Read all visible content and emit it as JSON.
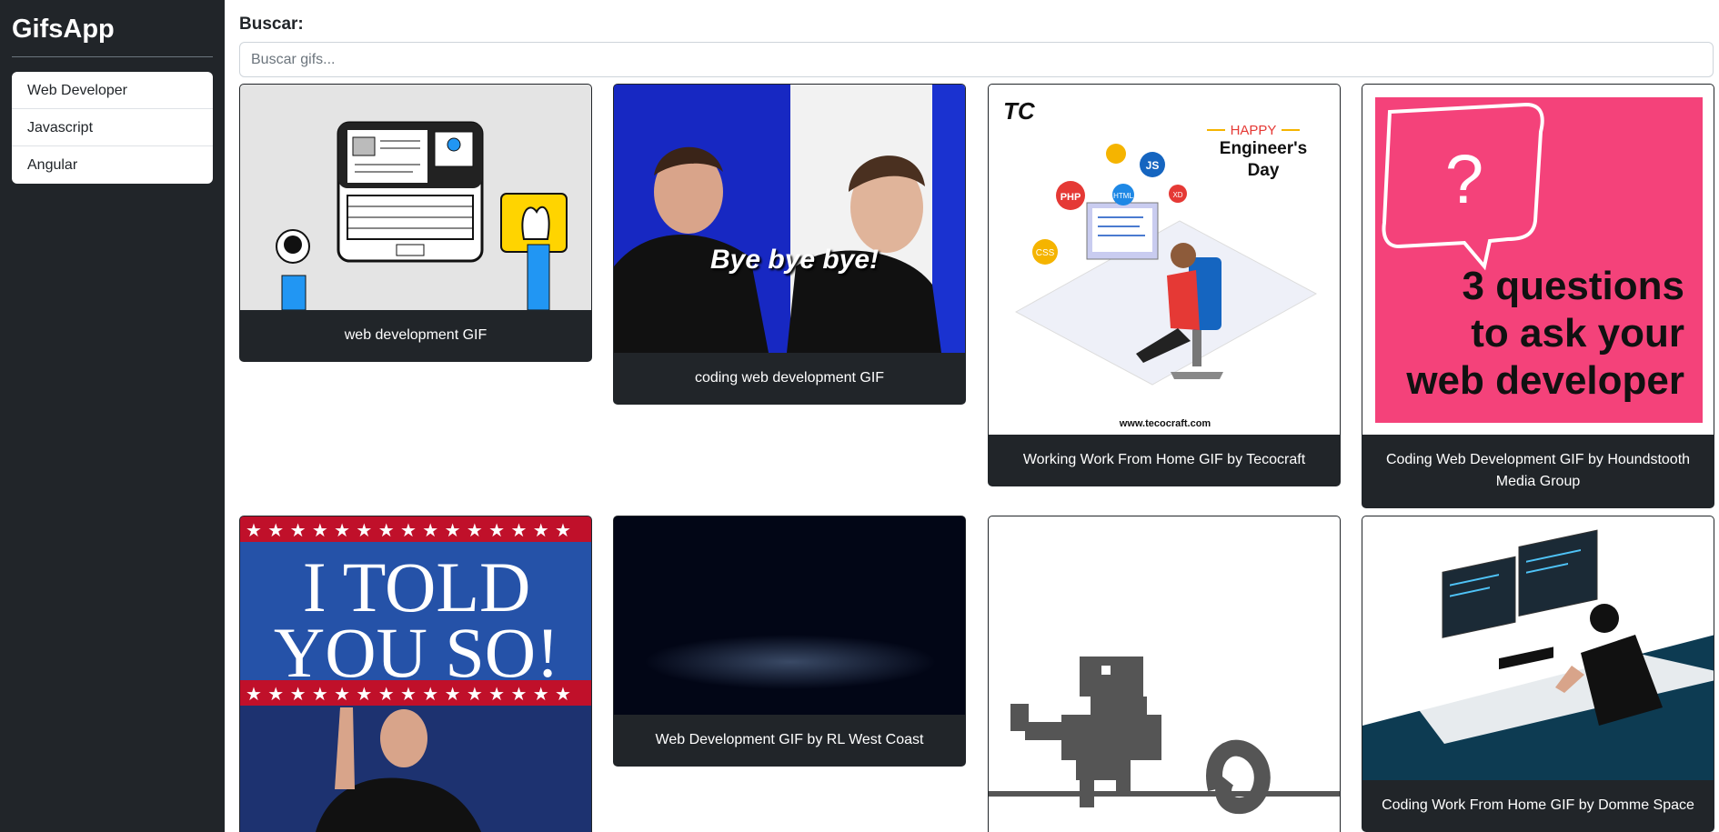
{
  "app": {
    "brand": "GifsApp"
  },
  "sidebar": {
    "items": [
      {
        "label": "Web Developer"
      },
      {
        "label": "Javascript"
      },
      {
        "label": "Angular"
      }
    ]
  },
  "search": {
    "label": "Buscar:",
    "placeholder": "Buscar gifs..."
  },
  "gifs": [
    {
      "title": "web development GIF"
    },
    {
      "title": "coding web development GIF",
      "image_text": "Bye bye bye!"
    },
    {
      "title": "Working Work From Home GIF by Tecocraft",
      "image_text": {
        "happy": "HAPPY",
        "line1": "Engineer's",
        "line2": "Day",
        "url": "www.tecocraft.com",
        "tags": [
          "PHP",
          "HTML",
          "JS",
          "CSS",
          "XD"
        ]
      }
    },
    {
      "title": "Coding Web Development GIF by Houndstooth Media Group",
      "image_text": {
        "q": "?",
        "lines": [
          "3 questions",
          "to ask your",
          "web developer"
        ]
      }
    },
    {
      "title": "",
      "image_text": {
        "line1": "I TOLD",
        "line2": "YOU SO!"
      }
    },
    {
      "title": "Web Development GIF by RL West Coast"
    },
    {
      "title": ""
    },
    {
      "title": "Coding Work From Home GIF by Domme Space"
    }
  ],
  "colors": {
    "sidebar_bg": "#212529",
    "card_title_bg": "#212529",
    "pink": "#f4427a"
  }
}
